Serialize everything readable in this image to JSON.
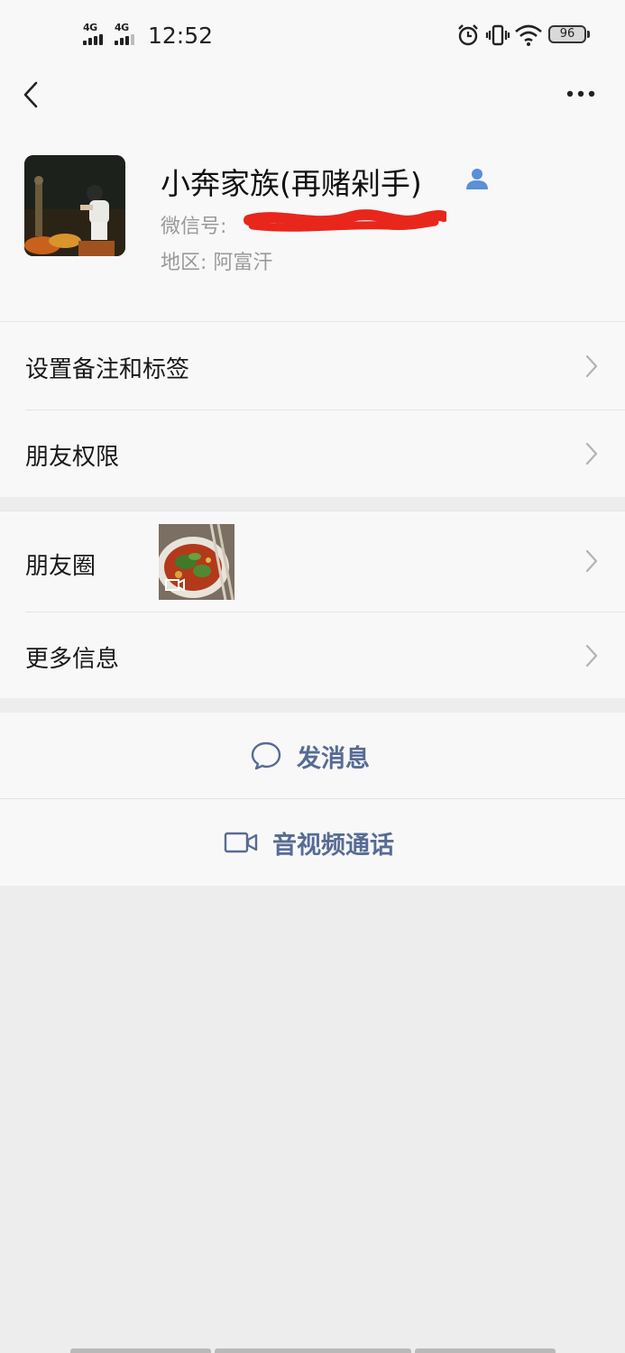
{
  "status_bar": {
    "sim1_label": "4G",
    "sim2_label": "4G",
    "time": "12:52",
    "battery_level": "96",
    "icons": [
      "alarm-icon",
      "vibrate-icon",
      "wifi-icon",
      "battery-icon"
    ]
  },
  "nav": {
    "back_icon": "chevron-left-icon",
    "more_icon": "more-dots-icon"
  },
  "profile": {
    "name": "小奔家族(再赌剁手)",
    "wechat_id_label": "微信号:",
    "region_label": "地区:",
    "region_value": "阿富汗",
    "badge_icon": "person-icon",
    "redaction_color": "#e8261b"
  },
  "menu_group_1": {
    "items": [
      {
        "label": "设置备注和标签"
      },
      {
        "label": "朋友权限"
      }
    ]
  },
  "menu_group_2": {
    "items": [
      {
        "label": "朋友圈"
      },
      {
        "label": "更多信息"
      }
    ]
  },
  "actions": {
    "send_message": "发消息",
    "av_call": "音视频通话"
  },
  "colors": {
    "link_blue": "#576b95",
    "background": "#ededed",
    "card": "#f8f8f8"
  }
}
